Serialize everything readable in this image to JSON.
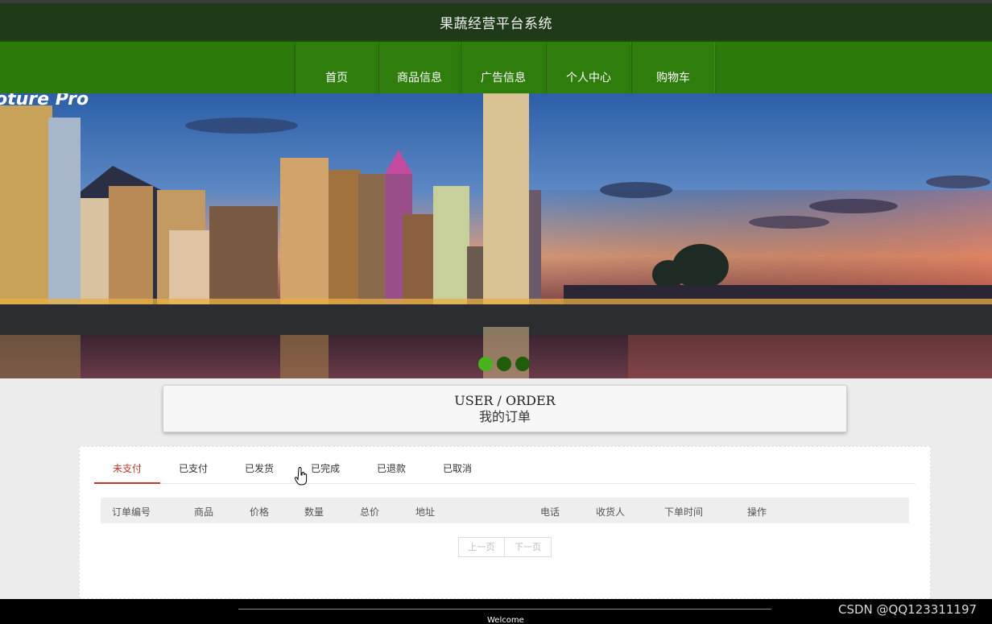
{
  "header": {
    "title": "果蔬经营平台系统"
  },
  "nav": {
    "items": [
      "首页",
      "商品信息",
      "广告信息",
      "个人中心",
      "购物车"
    ]
  },
  "banner": {
    "logo_text": "oture Pro",
    "slide_count": 3,
    "active_slide": 1
  },
  "order_section": {
    "title_en": "USER / ORDER",
    "title_cn": "我的订单"
  },
  "tabs": {
    "items": [
      "未支付",
      "已支付",
      "已发货",
      "已完成",
      "已退款",
      "已取消"
    ],
    "active": "未支付"
  },
  "table": {
    "columns": [
      "订单编号",
      "商品",
      "价格",
      "数量",
      "总价",
      "地址",
      "电话",
      "收货人",
      "下单时间",
      "操作"
    ],
    "rows": []
  },
  "pager": {
    "prev": "上一页",
    "next": "下一页"
  },
  "footer": {
    "welcome": "Welcome",
    "watermark": "CSDN @QQ123311197"
  },
  "colors": {
    "header_bg": "#1f3a19",
    "nav_bg": "#2d7a0c",
    "accent_red": "#c0392b",
    "dot_active": "#4ab21c"
  }
}
